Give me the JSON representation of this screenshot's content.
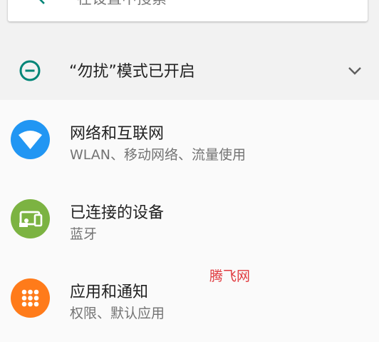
{
  "search": {
    "placeholder": "在设置中搜索",
    "back_icon": "back-arrow-icon"
  },
  "condition": {
    "title": "“勿扰”模式已开启",
    "icon": "do-not-disturb-icon",
    "expand_icon": "chevron-down-icon",
    "accent_color": "#008577"
  },
  "items": [
    {
      "title": "网络和互联网",
      "summary": "WLAN、移动网络、流量使用",
      "icon": "wifi-icon",
      "color": "#2196F3"
    },
    {
      "title": "已连接的设备",
      "summary": "蓝牙",
      "icon": "connected-devices-icon",
      "color": "#7CB342"
    },
    {
      "title": "应用和通知",
      "summary": "权限、默认应用",
      "icon": "apps-icon",
      "color": "#FF7B1A"
    }
  ],
  "watermark": "腾飞网"
}
